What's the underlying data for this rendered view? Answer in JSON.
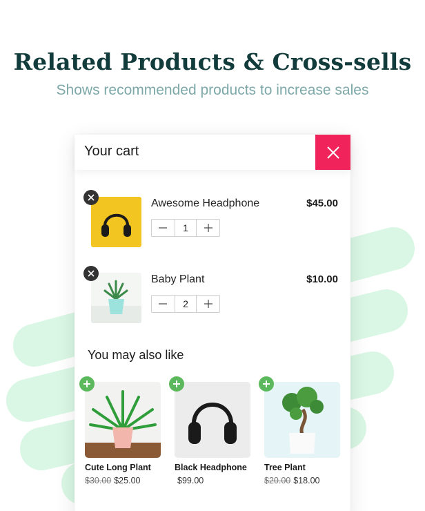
{
  "page": {
    "headline": "Related Products & Cross-sells",
    "subheadline": "Shows recommended products to increase sales"
  },
  "colors": {
    "headline": "#123b3b",
    "subheadline": "#7da8a8",
    "close_button": "#f0245a",
    "add_button": "#5cb85c",
    "background_swoosh": "#d9f7e4"
  },
  "cart": {
    "title": "Your cart",
    "close_icon": "close-icon",
    "items": [
      {
        "name": "Awesome Headphone",
        "price": "$45.00",
        "quantity": "1",
        "image_icon": "headphone-image"
      },
      {
        "name": "Baby Plant",
        "price": "$10.00",
        "quantity": "2",
        "image_icon": "plant-image"
      }
    ],
    "recommendations": {
      "title": "You may also like",
      "items": [
        {
          "name": "Cute Long Plant",
          "old_price": "$30.00",
          "price": "$25.00",
          "image_icon": "fern-image"
        },
        {
          "name": "Black Headphone",
          "old_price": "",
          "price": "$99.00",
          "image_icon": "headphone-image"
        },
        {
          "name": "Tree Plant",
          "old_price": "$20.00",
          "price": "$18.00",
          "image_icon": "bonsai-image"
        }
      ]
    }
  }
}
